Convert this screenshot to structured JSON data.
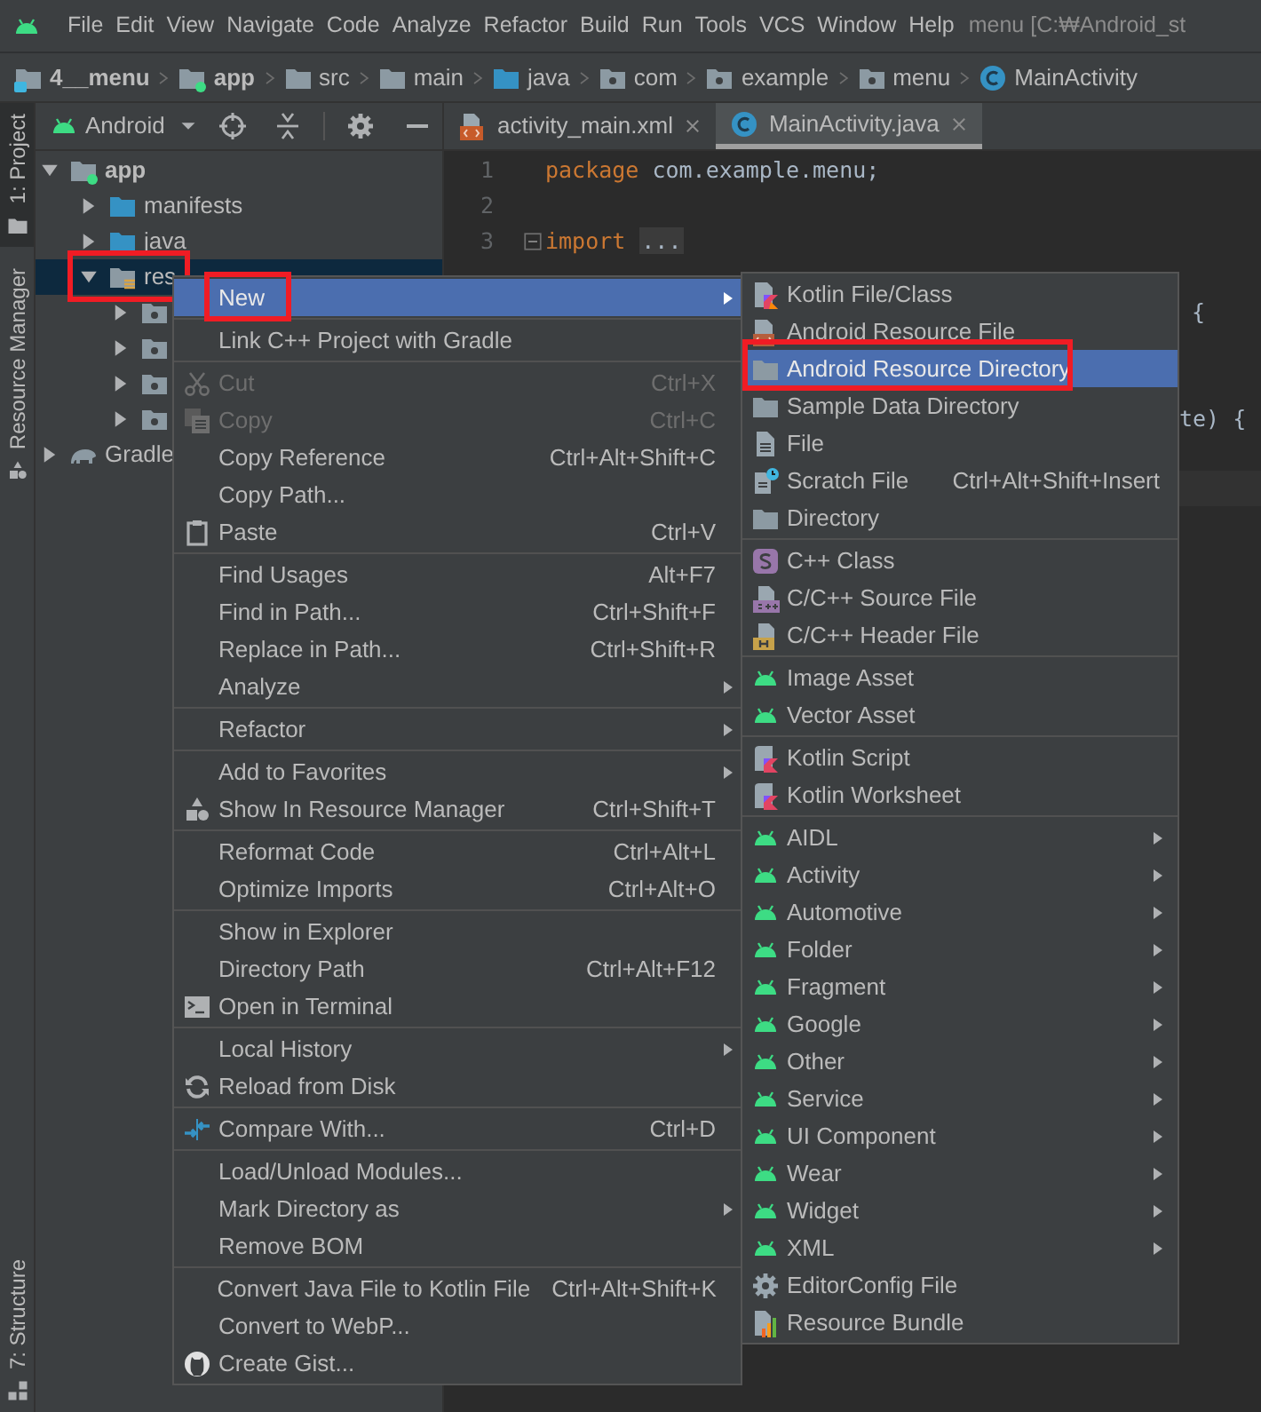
{
  "menu_bar": {
    "items": [
      "File",
      "Edit",
      "View",
      "Navigate",
      "Code",
      "Analyze",
      "Refactor",
      "Build",
      "Run",
      "Tools",
      "VCS",
      "Window",
      "Help"
    ],
    "title": "menu [C:₩Android_st"
  },
  "breadcrumbs": [
    {
      "label": "4__menu",
      "kind": "project"
    },
    {
      "label": "app",
      "kind": "module"
    },
    {
      "label": "src",
      "kind": "folder"
    },
    {
      "label": "main",
      "kind": "folder"
    },
    {
      "label": "java",
      "kind": "source"
    },
    {
      "label": "com",
      "kind": "package"
    },
    {
      "label": "example",
      "kind": "package"
    },
    {
      "label": "menu",
      "kind": "package"
    },
    {
      "label": "MainActivity",
      "kind": "class"
    }
  ],
  "tool_strip": [
    {
      "label": "1: Project",
      "selected": true
    },
    {
      "label": "Resource Manager",
      "selected": false
    },
    {
      "label": "7: Structure",
      "selected": false
    }
  ],
  "project_panel": {
    "view": "Android",
    "tree": [
      {
        "label": "app",
        "kind": "module",
        "expanded": true,
        "selected": false,
        "children": [
          {
            "label": "manifests",
            "kind": "folder",
            "expanded": false,
            "selected": false
          },
          {
            "label": "java",
            "kind": "folder",
            "expanded": false,
            "selected": false
          },
          {
            "label": "res",
            "kind": "res",
            "expanded": true,
            "selected": true,
            "annotated": true,
            "children": [
              {
                "kind": "package",
                "expanded": false,
                "selected": false
              },
              {
                "kind": "package",
                "expanded": false,
                "selected": false
              },
              {
                "kind": "package",
                "expanded": false,
                "selected": false
              },
              {
                "kind": "package",
                "expanded": false,
                "selected": false
              }
            ]
          }
        ]
      },
      {
        "label": "Gradle",
        "kind": "gradle",
        "expanded": false,
        "selected": false
      }
    ]
  },
  "editor": {
    "tabs": [
      {
        "label": "activity_main.xml",
        "kind": "xml",
        "selected": false
      },
      {
        "label": "MainActivity.java",
        "kind": "class",
        "selected": true
      }
    ],
    "lines": [
      {
        "number": "1",
        "tokens": [
          {
            "text": "package",
            "kind": "keyword"
          },
          {
            "text": " com.example.menu;",
            "kind": "plain"
          }
        ]
      },
      {
        "number": "2"
      },
      {
        "number": "3",
        "folded": true,
        "tokens": [
          {
            "text": "import",
            "kind": "keyword"
          },
          {
            "text": "...",
            "kind": "fold"
          }
        ]
      }
    ],
    "fragments": [
      "{",
      "te) {"
    ]
  },
  "context_menu": {
    "groups": [
      [
        {
          "label": "New",
          "kind": "text",
          "submenu": true,
          "selected": true,
          "annotated": true,
          "disabled": false
        }
      ],
      [
        {
          "label": "Link C++ Project with Gradle",
          "kind": "text",
          "disabled": false,
          "selected": false
        }
      ],
      [
        {
          "label": "Cut",
          "shortcut": "Ctrl+X",
          "kind": "scissors",
          "disabled": true,
          "selected": false
        },
        {
          "label": "Copy",
          "shortcut": "Ctrl+C",
          "kind": "copy",
          "disabled": true,
          "selected": false
        },
        {
          "label": "Copy Reference",
          "shortcut": "Ctrl+Alt+Shift+C",
          "kind": "text",
          "disabled": false,
          "selected": false
        },
        {
          "label": "Copy Path...",
          "kind": "text",
          "disabled": false,
          "selected": false
        },
        {
          "label": "Paste",
          "shortcut": "Ctrl+V",
          "kind": "paste",
          "disabled": false,
          "selected": false
        }
      ],
      [
        {
          "label": "Find Usages",
          "shortcut": "Alt+F7",
          "kind": "text",
          "disabled": false,
          "selected": false
        },
        {
          "label": "Find in Path...",
          "shortcut": "Ctrl+Shift+F",
          "kind": "text",
          "disabled": false,
          "selected": false
        },
        {
          "label": "Replace in Path...",
          "shortcut": "Ctrl+Shift+R",
          "kind": "text",
          "disabled": false,
          "selected": false
        },
        {
          "label": "Analyze",
          "kind": "text",
          "submenu": true,
          "disabled": false,
          "selected": false
        }
      ],
      [
        {
          "label": "Refactor",
          "kind": "text",
          "submenu": true,
          "disabled": false,
          "selected": false
        }
      ],
      [
        {
          "label": "Add to Favorites",
          "kind": "text",
          "submenu": true,
          "disabled": false,
          "selected": false
        },
        {
          "label": "Show In Resource Manager",
          "shortcut": "Ctrl+Shift+T",
          "kind": "shapes",
          "disabled": false,
          "selected": false
        }
      ],
      [
        {
          "label": "Reformat Code",
          "shortcut": "Ctrl+Alt+L",
          "kind": "text",
          "disabled": false,
          "selected": false
        },
        {
          "label": "Optimize Imports",
          "shortcut": "Ctrl+Alt+O",
          "kind": "text",
          "disabled": false,
          "selected": false
        }
      ],
      [
        {
          "label": "Show in Explorer",
          "kind": "text",
          "disabled": false,
          "selected": false
        },
        {
          "label": "Directory Path",
          "shortcut": "Ctrl+Alt+F12",
          "kind": "text",
          "disabled": false,
          "selected": false
        },
        {
          "label": "Open in Terminal",
          "kind": "terminal",
          "disabled": false,
          "selected": false
        }
      ],
      [
        {
          "label": "Local History",
          "kind": "text",
          "submenu": true,
          "disabled": false,
          "selected": false
        },
        {
          "label": "Reload from Disk",
          "kind": "reload",
          "disabled": false,
          "selected": false
        }
      ],
      [
        {
          "label": "Compare With...",
          "shortcut": "Ctrl+D",
          "kind": "compare",
          "disabled": false,
          "selected": false
        }
      ],
      [
        {
          "label": "Load/Unload Modules...",
          "kind": "text",
          "disabled": false,
          "selected": false
        },
        {
          "label": "Mark Directory as",
          "kind": "text",
          "submenu": true,
          "disabled": false,
          "selected": false
        },
        {
          "label": "Remove BOM",
          "kind": "text",
          "disabled": false,
          "selected": false
        }
      ],
      [
        {
          "label": "Convert Java File to Kotlin File",
          "shortcut": "Ctrl+Alt+Shift+K",
          "kind": "text",
          "disabled": false,
          "selected": false
        },
        {
          "label": "Convert to WebP...",
          "kind": "text",
          "disabled": false,
          "selected": false
        },
        {
          "label": "Create Gist...",
          "kind": "gist",
          "disabled": false,
          "selected": false
        }
      ]
    ]
  },
  "submenu": {
    "groups": [
      [
        {
          "label": "Kotlin File/Class",
          "kind": "kotlin",
          "selected": false
        },
        {
          "label": "Android Resource File",
          "kind": "resource",
          "selected": false
        },
        {
          "label": "Android Resource Directory",
          "kind": "folder",
          "selected": true,
          "annotated": true
        },
        {
          "label": "Sample Data Directory",
          "kind": "folder",
          "selected": false
        },
        {
          "label": "File",
          "kind": "file",
          "selected": false
        },
        {
          "label": "Scratch File",
          "shortcut": "Ctrl+Alt+Shift+Insert",
          "kind": "scratch",
          "selected": false
        },
        {
          "label": "Directory",
          "kind": "folder",
          "selected": false
        }
      ],
      [
        {
          "label": "C++ Class",
          "kind": "cppclass",
          "selected": false
        },
        {
          "label": "C/C++ Source File",
          "kind": "cppsource",
          "selected": false
        },
        {
          "label": "C/C++ Header File",
          "kind": "cppheader",
          "selected": false
        }
      ],
      [
        {
          "label": "Image Asset",
          "kind": "android",
          "selected": false
        },
        {
          "label": "Vector Asset",
          "kind": "android",
          "selected": false
        }
      ],
      [
        {
          "label": "Kotlin Script",
          "kind": "script",
          "selected": false
        },
        {
          "label": "Kotlin Worksheet",
          "kind": "script",
          "selected": false
        }
      ],
      [
        {
          "label": "AIDL",
          "kind": "android",
          "submenu": true,
          "selected": false
        },
        {
          "label": "Activity",
          "kind": "android",
          "submenu": true,
          "selected": false
        },
        {
          "label": "Automotive",
          "kind": "android",
          "submenu": true,
          "selected": false
        },
        {
          "label": "Folder",
          "kind": "android",
          "submenu": true,
          "selected": false
        },
        {
          "label": "Fragment",
          "kind": "android",
          "submenu": true,
          "selected": false
        },
        {
          "label": "Google",
          "kind": "android",
          "submenu": true,
          "selected": false
        },
        {
          "label": "Other",
          "kind": "android",
          "submenu": true,
          "selected": false
        },
        {
          "label": "Service",
          "kind": "android",
          "submenu": true,
          "selected": false
        },
        {
          "label": "UI Component",
          "kind": "android",
          "submenu": true,
          "selected": false
        },
        {
          "label": "Wear",
          "kind": "android",
          "submenu": true,
          "selected": false
        },
        {
          "label": "Widget",
          "kind": "android",
          "submenu": true,
          "selected": false
        },
        {
          "label": "XML",
          "kind": "android",
          "submenu": true,
          "selected": false
        },
        {
          "label": "EditorConfig File",
          "kind": "gear",
          "selected": false
        },
        {
          "label": "Resource Bundle",
          "kind": "bundle",
          "selected": false
        }
      ]
    ]
  }
}
